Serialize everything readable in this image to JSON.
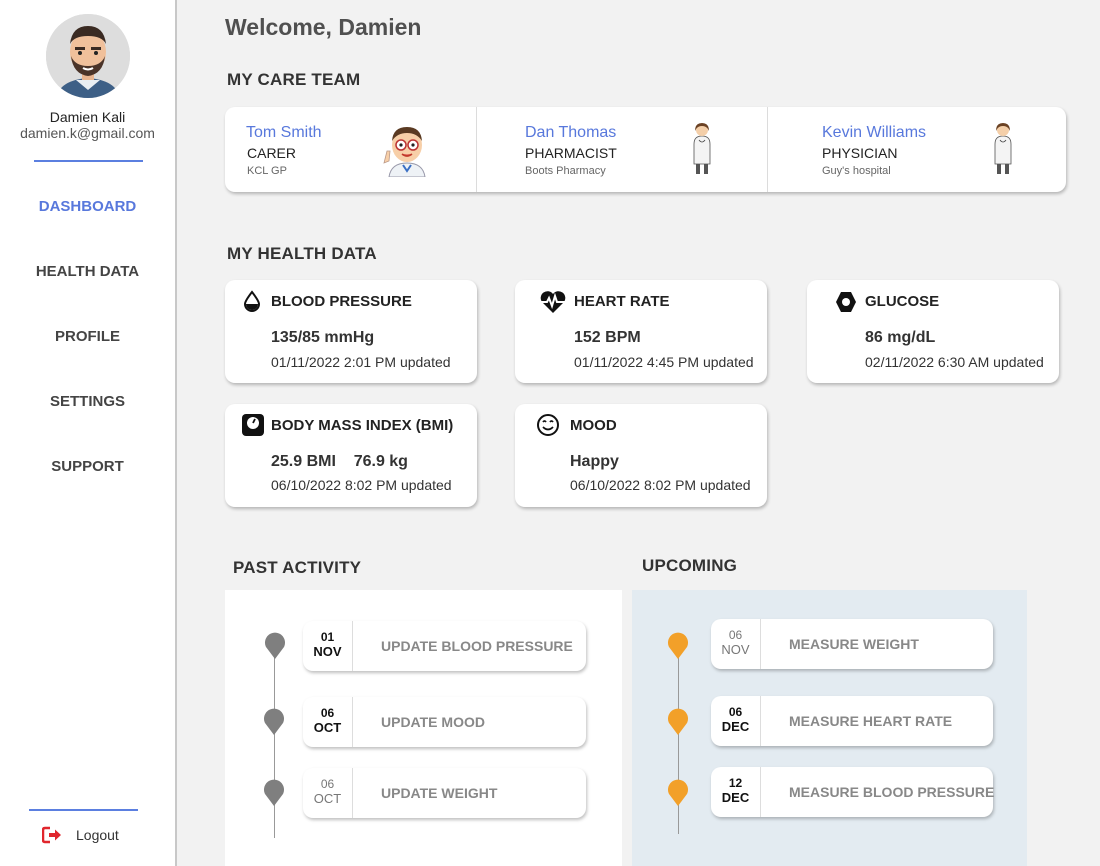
{
  "user": {
    "name": "Damien Kali",
    "email": "damien.k@gmail.com"
  },
  "nav": [
    {
      "label": "DASHBOARD",
      "active": true
    },
    {
      "label": "HEALTH DATA"
    },
    {
      "label": "PROFILE"
    },
    {
      "label": "SETTINGS"
    },
    {
      "label": "SUPPORT"
    }
  ],
  "logout_label": "Logout",
  "welcome": "Welcome, Damien",
  "care_team": {
    "title": "MY CARE TEAM",
    "members": [
      {
        "name": "Tom Smith",
        "role": "CARER",
        "org": "KCL GP"
      },
      {
        "name": "Dan Thomas",
        "role": "PHARMACIST",
        "org": "Boots Pharmacy"
      },
      {
        "name": "Kevin Williams",
        "role": "PHYSICIAN",
        "org": "Guy's hospital"
      }
    ]
  },
  "health": {
    "title": "MY HEALTH DATA",
    "cards": [
      {
        "title": "BLOOD PRESSURE",
        "value": "135/85 mmHg",
        "updated": "01/11/2022 2:01 PM updated",
        "icon": "drop-icon"
      },
      {
        "title": "HEART RATE",
        "value": "152 BPM",
        "updated": "01/11/2022 4:45 PM updated",
        "icon": "heartbeat-icon"
      },
      {
        "title": "GLUCOSE",
        "value": "86 mg/dL",
        "updated": "02/11/2022 6:30 AM updated",
        "icon": "hexagon-icon"
      },
      {
        "title": "BODY MASS INDEX (BMI)",
        "value": "25.9 BMI    76.9 kg",
        "updated": "06/10/2022 8:02 PM updated",
        "icon": "scale-icon"
      },
      {
        "title": "MOOD",
        "value": "Happy",
        "updated": "06/10/2022 8:02 PM updated",
        "icon": "smiley-icon"
      }
    ]
  },
  "past": {
    "title": "PAST ACTIVITY",
    "items": [
      {
        "day": "01",
        "month": "NOV",
        "label": "UPDATE BLOOD PRESSURE"
      },
      {
        "day": "06",
        "month": "OCT",
        "label": "UPDATE MOOD"
      },
      {
        "day": "06",
        "month": "OCT",
        "label": "UPDATE WEIGHT"
      }
    ]
  },
  "upcoming": {
    "title": "UPCOMING",
    "items": [
      {
        "day": "06",
        "month": "NOV",
        "label": "MEASURE WEIGHT"
      },
      {
        "day": "06",
        "month": "DEC",
        "label": "MEASURE HEART RATE"
      },
      {
        "day": "12",
        "month": "DEC",
        "label": "MEASURE BLOOD PRESSURE"
      }
    ]
  },
  "colors": {
    "accent": "#5878dc",
    "pin_past": "#7f7f7f",
    "pin_upcoming": "#f2a029",
    "logout_icon": "#e0262d"
  }
}
